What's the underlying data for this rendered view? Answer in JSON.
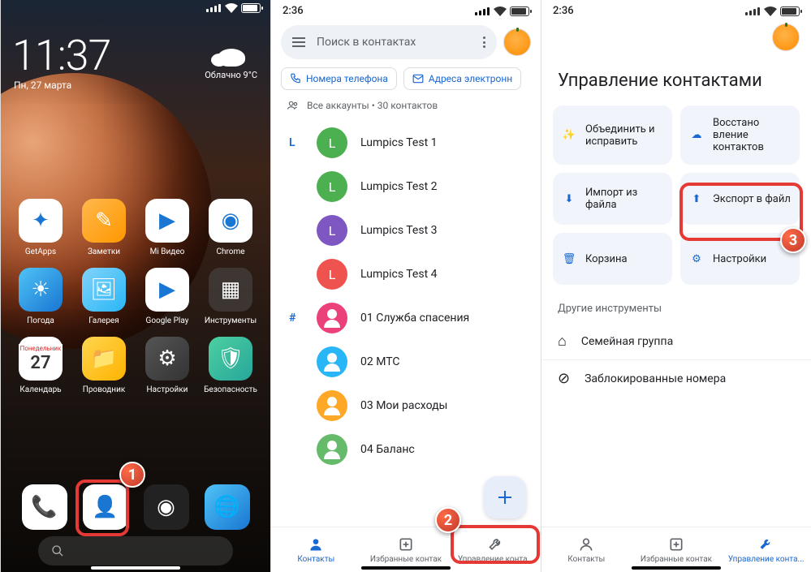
{
  "s1": {
    "time": "11:37",
    "date": "Пн, 27 марта",
    "weather": "Облачно  9°C",
    "apps": [
      {
        "label": "GetApps",
        "bg": "#fff",
        "glyph": "✦"
      },
      {
        "label": "Заметки",
        "bg": "linear-gradient(135deg,#ffb84d,#ff9800)",
        "glyph": "✎"
      },
      {
        "label": "Mi Видео",
        "bg": "#fff",
        "glyph": "▶"
      },
      {
        "label": "Chrome",
        "bg": "#fff",
        "glyph": "◉"
      },
      {
        "label": "Погода",
        "bg": "linear-gradient(135deg,#4fc3f7,#1976d2)",
        "glyph": "☀"
      },
      {
        "label": "Галерея",
        "bg": "linear-gradient(135deg,#81d4fa,#29b6f6)",
        "glyph": "🖼"
      },
      {
        "label": "Google Play",
        "bg": "#fff",
        "glyph": "▶"
      },
      {
        "label": "Инструменты",
        "bg": "rgba(80,80,80,0.5)",
        "glyph": "▦"
      },
      {
        "label": "Календарь",
        "bg": "#fff",
        "glyph": "27"
      },
      {
        "label": "Проводник",
        "bg": "linear-gradient(135deg,#ffd54f,#ffb300)",
        "glyph": "📁"
      },
      {
        "label": "Настройки",
        "bg": "linear-gradient(135deg,#555,#333)",
        "glyph": "⚙"
      },
      {
        "label": "Безопасность",
        "bg": "linear-gradient(135deg,#4dd0a1,#26a69a)",
        "glyph": "🛡"
      }
    ],
    "cal_head": "Понедельник",
    "dock": [
      {
        "name": "phone",
        "bg": "#fff",
        "glyph": "📞"
      },
      {
        "name": "contacts",
        "bg": "#fff",
        "glyph": "👤"
      },
      {
        "name": "camera",
        "bg": "#222",
        "glyph": "◉"
      },
      {
        "name": "browser",
        "bg": "linear-gradient(135deg,#4fc3f7,#1976d2)",
        "glyph": "🌐"
      }
    ],
    "step": "1"
  },
  "s2": {
    "time": "2:36",
    "search": "Поиск в контактах",
    "chip1": "Номера телефона",
    "chip2": "Адреса электронн",
    "summary": "Все аккаунты • 30 контактов",
    "sections": [
      {
        "idx": "L",
        "items": [
          {
            "n": "Lumpics Test 1",
            "c": "#4caf50",
            "l": "L"
          },
          {
            "n": "Lumpics Test 2",
            "c": "#4caf50",
            "l": "L"
          },
          {
            "n": "Lumpics Test 3",
            "c": "#7e57c2",
            "l": "L"
          },
          {
            "n": "Lumpics Test 4",
            "c": "#ef5350",
            "l": "L"
          }
        ]
      },
      {
        "idx": "#",
        "items": [
          {
            "n": "01 Служба спасения",
            "c": "#ec407a",
            "l": ""
          },
          {
            "n": "02 МТС",
            "c": "#29b6f6",
            "l": ""
          },
          {
            "n": "03 Мои расходы",
            "c": "#ffa726",
            "l": ""
          },
          {
            "n": "04 Баланс",
            "c": "#66bb6a",
            "l": ""
          }
        ]
      }
    ],
    "nav": [
      "Контакты",
      "Избранные контак",
      "Управление конта..."
    ],
    "step": "2"
  },
  "s3": {
    "time": "2:36",
    "title": "Управление контактами",
    "cards": [
      {
        "t": "Объединить и исправить",
        "ic": "✨"
      },
      {
        "t": "Восстано вление контактов",
        "ic": "☁"
      },
      {
        "t": "Импорт из файла",
        "ic": "⬇"
      },
      {
        "t": "Экспорт в файл",
        "ic": "⬆"
      },
      {
        "t": "Корзина",
        "ic": "🗑"
      },
      {
        "t": "Настройки",
        "ic": "⚙"
      }
    ],
    "section": "Другие инструменты",
    "links": [
      {
        "t": "Семейная группа",
        "ic": "⌂"
      },
      {
        "t": "Заблокированные номера",
        "ic": "⊘"
      }
    ],
    "nav": [
      "Контакты",
      "Избранные контак",
      "Управление конта..."
    ],
    "step": "3"
  }
}
